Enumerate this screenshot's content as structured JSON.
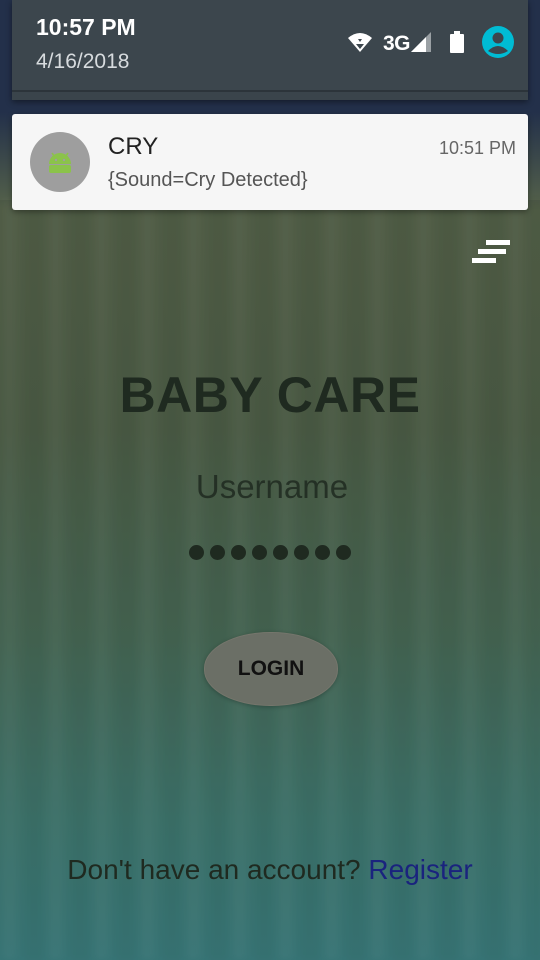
{
  "status_bar": {
    "time": "10:57 PM",
    "date": "4/16/2018",
    "network": "3G",
    "icons": [
      "wifi-icon",
      "cellular-signal-icon",
      "battery-icon",
      "account-circle-icon"
    ],
    "accent_color": "#00bcd4"
  },
  "notification": {
    "app_icon": "android-icon",
    "title": "CRY",
    "text": "{Sound=Cry Detected}",
    "time": "10:51 PM"
  },
  "app": {
    "menu_icon": "menu-icon",
    "title": "BABY CARE",
    "username_placeholder": "Username",
    "password_masked": "●●●●●●●●",
    "login_label": "LOGIN",
    "footer_text": "Don't have an account?",
    "register_label": "Register",
    "colors": {
      "register_link": "#1a237e",
      "login_button": "#6b6f66"
    }
  }
}
